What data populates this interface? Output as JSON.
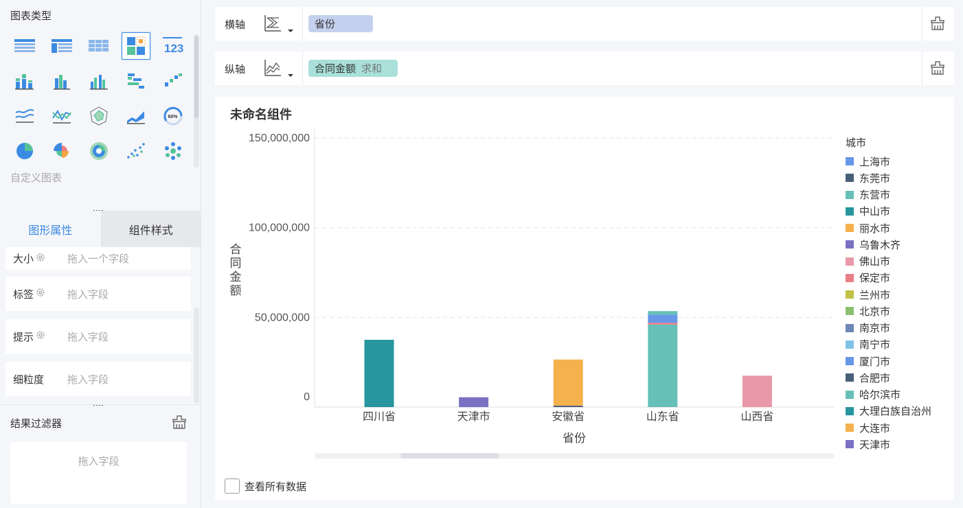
{
  "sidebar": {
    "chart_type_title": "图表类型",
    "custom_chart_label": "自定义图表",
    "tabs": [
      {
        "label": "图形属性",
        "active": true
      },
      {
        "label": "组件样式",
        "active": false
      }
    ],
    "properties": [
      {
        "label": "大小",
        "has_gear": true,
        "placeholder": "拖入一个字段"
      },
      {
        "label": "标签",
        "has_gear": true,
        "placeholder": "拖入字段"
      },
      {
        "label": "提示",
        "has_gear": true,
        "placeholder": "拖入字段"
      },
      {
        "label": "细粒度",
        "has_gear": false,
        "placeholder": "拖入字段"
      }
    ],
    "filter_title": "结果过滤器",
    "filter_placeholder": "拖入字段",
    "chart_type_icons": [
      "table-icon",
      "cross-table-icon",
      "detail-table-icon",
      "heatmap-table-icon",
      "kpi-number-icon",
      "stacked-bar-icon",
      "grouped-bar-icon",
      "multi-bar-icon",
      "horizontal-bar-icon",
      "waterfall-icon",
      "line-icon",
      "multi-line-icon",
      "radar-icon",
      "area-icon",
      "gauge-icon",
      "pie-icon",
      "rose-pie-icon",
      "multi-pie-icon",
      "scatter-icon",
      "bubble-icon"
    ],
    "kpi_icon_text": "123",
    "gauge_icon_text": "60%",
    "selected_chart_type": 3
  },
  "axes": {
    "x_label": "横轴",
    "x_field": "省份",
    "y_label": "纵轴",
    "y_field": "合同金额",
    "y_agg": "求和"
  },
  "component": {
    "title": "未命名组件",
    "view_all_label": "查看所有数据"
  },
  "colors": {
    "accent": "#3c8be3",
    "x_pill": "#c4d1ee",
    "y_pill": "#a9e0da"
  },
  "chart_data": {
    "type": "bar",
    "stacked": true,
    "categories": [
      "四川省",
      "天津市",
      "安徽省",
      "山东省",
      "山西省"
    ],
    "xlabel": "省份",
    "ylabel": "合同金额",
    "yticks": [
      0,
      50000000,
      100000000,
      150000000
    ],
    "ytick_labels": [
      "0",
      "50,000,000",
      "100,000,000",
      "150,000,000"
    ],
    "ylim": [
      0,
      150000000
    ],
    "legend_title": "城市",
    "legend": [
      {
        "name": "上海市",
        "color": "#6897e8"
      },
      {
        "name": "东莞市",
        "color": "#4a5e7a"
      },
      {
        "name": "东营市",
        "color": "#67c0b8"
      },
      {
        "name": "中山市",
        "color": "#27969e"
      },
      {
        "name": "丽水市",
        "color": "#f5b14d"
      },
      {
        "name": "乌鲁木齐",
        "color": "#7b71c4"
      },
      {
        "name": "佛山市",
        "color": "#e898a8"
      },
      {
        "name": "保定市",
        "color": "#e87e86"
      },
      {
        "name": "兰州市",
        "color": "#c0c146"
      },
      {
        "name": "北京市",
        "color": "#8ac071"
      },
      {
        "name": "南京市",
        "color": "#6f87b5"
      },
      {
        "name": "南宁市",
        "color": "#7fc2e8"
      },
      {
        "name": "厦门市",
        "color": "#6897e8"
      },
      {
        "name": "合肥市",
        "color": "#4a5e7a"
      },
      {
        "name": "哈尔滨市",
        "color": "#67c0b8"
      },
      {
        "name": "大理白族自治州",
        "color": "#27969e"
      },
      {
        "name": "大连市",
        "color": "#f5b14d"
      },
      {
        "name": "天津市",
        "color": "#7b71c4"
      }
    ],
    "stacks": [
      {
        "category": "四川省",
        "segments": [
          {
            "name": "中山市",
            "color": "#27969e",
            "value": 37500000
          }
        ]
      },
      {
        "category": "天津市",
        "segments": [
          {
            "name": "天津市",
            "color": "#7b71c4",
            "value": 5500000
          }
        ]
      },
      {
        "category": "安徽省",
        "segments": [
          {
            "name": "合肥市",
            "color": "#4a5e7a",
            "value": 800000
          },
          {
            "name": "丽水市",
            "color": "#f5b14d",
            "value": 25700000
          }
        ]
      },
      {
        "category": "山东省",
        "segments": [
          {
            "name": "东营市",
            "color": "#67c0b8",
            "value": 46000000
          },
          {
            "name": "保定市",
            "color": "#e87e86",
            "value": 1000000
          },
          {
            "name": "上海市",
            "color": "#6897e8",
            "value": 4500000
          },
          {
            "name": "东营市",
            "color": "#67c0b8",
            "value": 2000000
          }
        ]
      },
      {
        "category": "山西省",
        "segments": [
          {
            "name": "佛山市",
            "color": "#e898a8",
            "value": 17500000
          }
        ]
      }
    ]
  }
}
